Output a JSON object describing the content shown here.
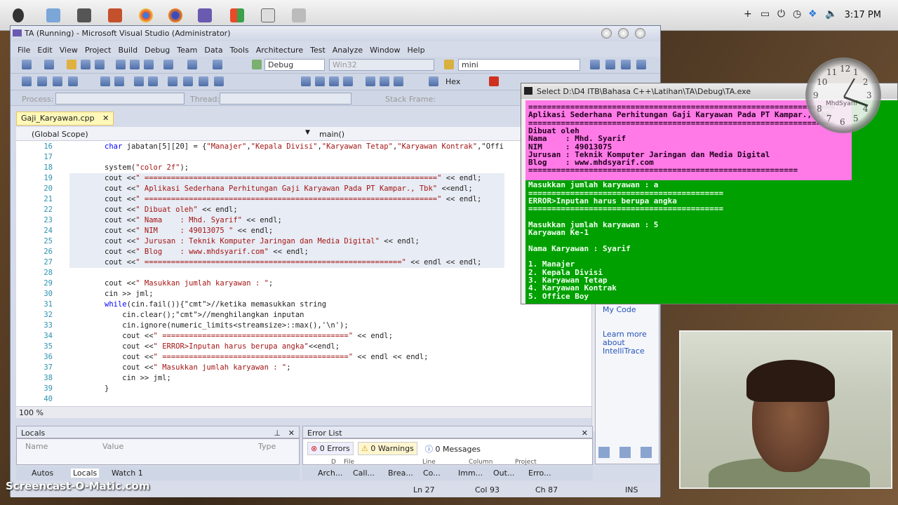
{
  "menubar": {
    "time": "3:17 PM"
  },
  "vs": {
    "title": "TA (Running) - Microsoft Visual Studio (Administrator)",
    "menu": [
      "File",
      "Edit",
      "View",
      "Project",
      "Build",
      "Debug",
      "Team",
      "Data",
      "Tools",
      "Architecture",
      "Test",
      "Analyze",
      "Window",
      "Help"
    ],
    "toolbar1": {
      "config": "Debug",
      "platform": "Win32",
      "find": "mini"
    },
    "toolbar2": {
      "hex": "Hex"
    },
    "toolbar3": {
      "process_label": "Process:",
      "thread_label": "Thread:",
      "stack_label": "Stack Frame:"
    },
    "tab": "Gaji_Karyawan.cpp",
    "scope": "(Global Scope)",
    "member": "main()",
    "zoom": "100 %",
    "code_lines": [
      {
        "n": "16",
        "t": "char jabatan[5][20] = {\"Manajer\",\"Kepala Divisi\",\"Karyawan Tetap\",\"Karyawan Kontrak\",\"Offi"
      },
      {
        "n": "17",
        "t": ""
      },
      {
        "n": "18",
        "t": "system(\"color 2f\");"
      },
      {
        "n": "19",
        "t": "cout <<\" ==================================================================\" << endl;"
      },
      {
        "n": "20",
        "t": "cout <<\" Aplikasi Sederhana Perhitungan Gaji Karyawan Pada PT Kampar., Tbk\" <<endl;"
      },
      {
        "n": "21",
        "t": "cout <<\" ==================================================================\" << endl;"
      },
      {
        "n": "22",
        "t": "cout <<\" Dibuat oleh\" << endl;"
      },
      {
        "n": "23",
        "t": "cout <<\" Nama    : Mhd. Syarif\" << endl;"
      },
      {
        "n": "24",
        "t": "cout <<\" NIM     : 49013075 \" << endl;"
      },
      {
        "n": "25",
        "t": "cout <<\" Jurusan : Teknik Komputer Jaringan dan Media Digital\" << endl;"
      },
      {
        "n": "26",
        "t": "cout <<\" Blog    : www.mhdsyarif.com\" << endl;"
      },
      {
        "n": "27",
        "t": "cout <<\" ==========================================================\" << endl << endl;"
      },
      {
        "n": "28",
        "t": ""
      },
      {
        "n": "29",
        "t": "cout <<\" Masukkan jumlah karyawan : \";"
      },
      {
        "n": "30",
        "t": "cin >> jml;"
      },
      {
        "n": "31",
        "t": "while(cin.fail()){//ketika memasukkan string"
      },
      {
        "n": "32",
        "t": "    cin.clear();//menghilangkan inputan"
      },
      {
        "n": "33",
        "t": "    cin.ignore(numeric_limits<streamsize>::max(),'\\n');"
      },
      {
        "n": "34",
        "t": "    cout <<\" ==========================================\" << endl;"
      },
      {
        "n": "35",
        "t": "    cout <<\" ERROR>Inputan harus berupa angka\"<<endl;"
      },
      {
        "n": "36",
        "t": "    cout <<\" ==========================================\" << endl << endl;"
      },
      {
        "n": "37",
        "t": "    cout <<\" Masukkan jumlah karyawan : \";"
      },
      {
        "n": "38",
        "t": "    cin >> jml;"
      },
      {
        "n": "39",
        "t": "}"
      },
      {
        "n": "40",
        "t": ""
      }
    ],
    "locals": {
      "title": "Locals",
      "col_name": "Name",
      "col_value": "Value",
      "col_type": "Type"
    },
    "errorlist": {
      "title": "Error List",
      "errors": "0 Errors",
      "warnings": "0 Warnings",
      "messages": "0 Messages",
      "cols": [
        "D",
        "File",
        "Line",
        "Column",
        "Project"
      ]
    },
    "bottom_tabs_left": [
      "Autos",
      "Locals",
      "Watch 1"
    ],
    "bottom_tabs_right": [
      "Arch...",
      "Call...",
      "Brea...",
      "Co...",
      "Imm...",
      "Out...",
      "Erro..."
    ],
    "status": {
      "ln": "Ln 27",
      "col": "Col 93",
      "ch": "Ch 87",
      "ins": "INS"
    },
    "side": {
      "my_code": "My Code",
      "learn": "Learn more about IntelliTrace"
    }
  },
  "console": {
    "title": "Select D:\\D4 ITB\\Bahasa C++\\Latihan\\TA\\Debug\\TA.exe",
    "pink_lines": [
      "==================================================================",
      "Aplikasi Sederhana Perhitungan Gaji Karyawan Pada PT Kampar., Tbk",
      "==================================================================",
      "Dibuat oleh",
      "Nama    : Mhd. Syarif",
      "NIM     : 49013075",
      "Jurusan : Teknik Komputer Jaringan dan Media Digital",
      "Blog    : www.mhdsyarif.com",
      "=========================================================="
    ],
    "green_lines": [
      "",
      "Masukkan jumlah karyawan : a",
      "==========================================",
      "ERROR>Inputan harus berupa angka",
      "==========================================",
      "",
      "Masukkan jumlah karyawan : 5",
      "Karyawan Ke-1",
      "",
      "Nama Karyawan : Syarif",
      "",
      "1. Manajer",
      "2. Kepala Divisi",
      "3. Karyawan Tetap",
      "4. Karyawan Kontrak",
      "5. Office Boy"
    ]
  },
  "clock": {
    "brand": "MhdSyarif",
    "numbers": [
      "12",
      "1",
      "2",
      "3",
      "4",
      "5",
      "6",
      "7",
      "8",
      "9",
      "10",
      "11"
    ]
  },
  "watermark": "Screencast-O-Matic.com"
}
